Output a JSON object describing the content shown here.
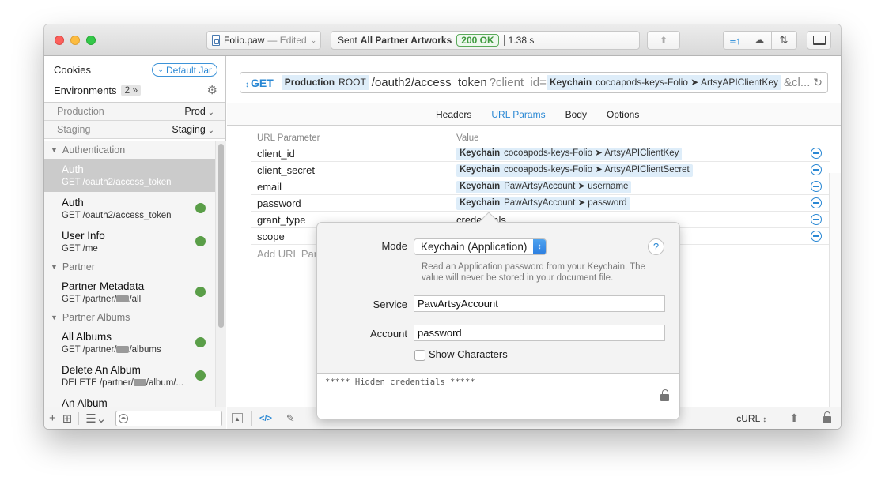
{
  "titlebar": {
    "document_name": "Folio.paw",
    "document_state": "— Edited",
    "status_prefix": "Sent",
    "status_request": "All Partner Artworks",
    "status_code": "200 OK",
    "status_time": "1.38 s",
    "layout_buttons": [
      "request-response-vertical-icon",
      "cloud-sync-icon",
      "swap-panels-icon"
    ],
    "panel_toggle_icon": "bottom-panel-icon"
  },
  "sidebar": {
    "cookies_label": "Cookies",
    "cookie_jar": "Default Jar",
    "environments_label": "Environments",
    "environments_count": "2 »",
    "env_rows": [
      {
        "name": "Production",
        "value": "Prod"
      },
      {
        "name": "Staging",
        "value": "Staging"
      }
    ],
    "groups": [
      {
        "label": "Authentication",
        "items": [
          {
            "name": "Auth",
            "method": "GET",
            "path": "/oauth2/access_token",
            "selected": true,
            "status": null
          },
          {
            "name": "Auth",
            "method": "GET",
            "path": "/oauth2/access_token",
            "selected": false,
            "status": "success"
          },
          {
            "name": "User Info",
            "method": "GET",
            "path": "/me",
            "selected": false,
            "status": "success"
          }
        ]
      },
      {
        "label": "Partner",
        "items": [
          {
            "name": "Partner Metadata",
            "method": "GET",
            "path_prefix": "/partner/",
            "path_suffix": "/all",
            "status": "success"
          }
        ]
      },
      {
        "label": "Partner Albums",
        "items": [
          {
            "name": "All Albums",
            "method": "GET",
            "path_prefix": "/partner/",
            "path_suffix": "/albums",
            "status": "success"
          },
          {
            "name": "Delete An Album",
            "method": "DELETE",
            "path_prefix": "/partner/",
            "path_suffix": "/album/...",
            "status": "success"
          },
          {
            "name": "An Album",
            "method": "",
            "path_prefix": "",
            "path_suffix": "",
            "status": null
          }
        ]
      }
    ],
    "footer": {
      "add_icon": "plus-icon",
      "add_group_icon": "new-folder-icon",
      "sort_icon": "sort-menu-icon",
      "filter_placeholder": ""
    }
  },
  "request": {
    "method": "GET",
    "env_token": {
      "label": "Production",
      "value": "ROOT"
    },
    "path": "/oauth2/access_token",
    "query_start": "?client_id=",
    "client_id_token": {
      "label": "Keychain",
      "value": "cocoapods-keys-Folio ➤ ArtsyAPIClientKey"
    },
    "query_more": "&cl..."
  },
  "tabs": [
    {
      "label": "Headers",
      "active": false
    },
    {
      "label": "URL Params",
      "active": true
    },
    {
      "label": "Body",
      "active": false
    },
    {
      "label": "Options",
      "active": false
    }
  ],
  "params": {
    "header_name": "URL Parameter",
    "header_value": "Value",
    "rows": [
      {
        "name": "client_id",
        "token": "Keychain",
        "value": "cocoapods-keys-Folio ➤ ArtsyAPIClientKey"
      },
      {
        "name": "client_secret",
        "token": "Keychain",
        "value": "cocoapods-keys-Folio ➤ ArtsyAPIClientSecret"
      },
      {
        "name": "email",
        "token": "Keychain",
        "value": "PawArtsyAccount ➤ username"
      },
      {
        "name": "password",
        "token": "Keychain",
        "value": "PawArtsyAccount ➤ password"
      },
      {
        "name": "grant_type",
        "token": "",
        "value": "credentials"
      },
      {
        "name": "scope",
        "token": "",
        "value": ""
      }
    ],
    "add_placeholder": "Add URL Parameter"
  },
  "popover": {
    "mode_label": "Mode",
    "mode_value": "Keychain (Application)",
    "help": "?",
    "description": "Read an Application password from your Keychain. The value will never be stored in your document file.",
    "service_label": "Service",
    "service_value": "PawArtsyAccount",
    "account_label": "Account",
    "account_value": "password",
    "show_characters_label": "Show Characters",
    "show_characters_checked": false,
    "preview": "***** Hidden credentials *****"
  },
  "footer": {
    "code_icon": "</>",
    "generator": "cURL"
  }
}
